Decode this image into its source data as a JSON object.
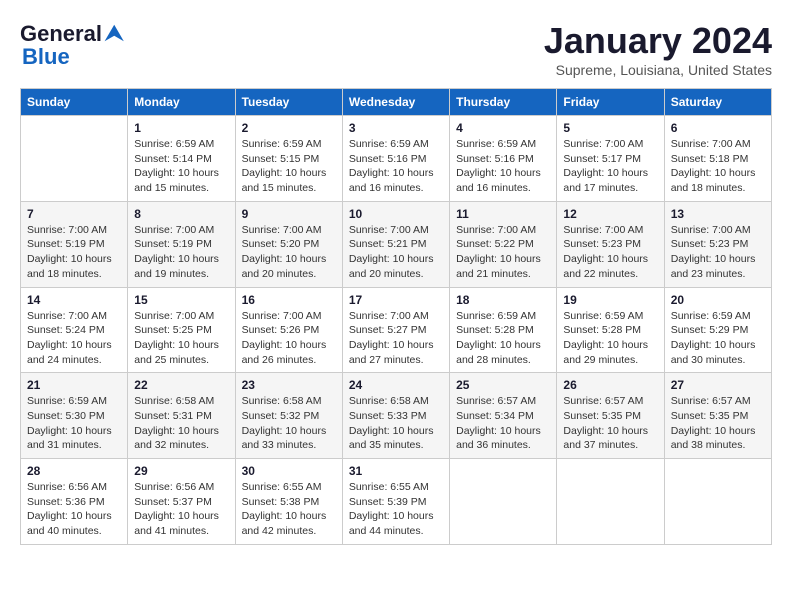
{
  "header": {
    "logo_line1": "General",
    "logo_line2": "Blue",
    "month_title": "January 2024",
    "subtitle": "Supreme, Louisiana, United States"
  },
  "days_of_week": [
    "Sunday",
    "Monday",
    "Tuesday",
    "Wednesday",
    "Thursday",
    "Friday",
    "Saturday"
  ],
  "weeks": [
    [
      {
        "day": "",
        "info": ""
      },
      {
        "day": "1",
        "info": "Sunrise: 6:59 AM\nSunset: 5:14 PM\nDaylight: 10 hours\nand 15 minutes."
      },
      {
        "day": "2",
        "info": "Sunrise: 6:59 AM\nSunset: 5:15 PM\nDaylight: 10 hours\nand 15 minutes."
      },
      {
        "day": "3",
        "info": "Sunrise: 6:59 AM\nSunset: 5:16 PM\nDaylight: 10 hours\nand 16 minutes."
      },
      {
        "day": "4",
        "info": "Sunrise: 6:59 AM\nSunset: 5:16 PM\nDaylight: 10 hours\nand 16 minutes."
      },
      {
        "day": "5",
        "info": "Sunrise: 7:00 AM\nSunset: 5:17 PM\nDaylight: 10 hours\nand 17 minutes."
      },
      {
        "day": "6",
        "info": "Sunrise: 7:00 AM\nSunset: 5:18 PM\nDaylight: 10 hours\nand 18 minutes."
      }
    ],
    [
      {
        "day": "7",
        "info": "Sunrise: 7:00 AM\nSunset: 5:19 PM\nDaylight: 10 hours\nand 18 minutes."
      },
      {
        "day": "8",
        "info": "Sunrise: 7:00 AM\nSunset: 5:19 PM\nDaylight: 10 hours\nand 19 minutes."
      },
      {
        "day": "9",
        "info": "Sunrise: 7:00 AM\nSunset: 5:20 PM\nDaylight: 10 hours\nand 20 minutes."
      },
      {
        "day": "10",
        "info": "Sunrise: 7:00 AM\nSunset: 5:21 PM\nDaylight: 10 hours\nand 20 minutes."
      },
      {
        "day": "11",
        "info": "Sunrise: 7:00 AM\nSunset: 5:22 PM\nDaylight: 10 hours\nand 21 minutes."
      },
      {
        "day": "12",
        "info": "Sunrise: 7:00 AM\nSunset: 5:23 PM\nDaylight: 10 hours\nand 22 minutes."
      },
      {
        "day": "13",
        "info": "Sunrise: 7:00 AM\nSunset: 5:23 PM\nDaylight: 10 hours\nand 23 minutes."
      }
    ],
    [
      {
        "day": "14",
        "info": "Sunrise: 7:00 AM\nSunset: 5:24 PM\nDaylight: 10 hours\nand 24 minutes."
      },
      {
        "day": "15",
        "info": "Sunrise: 7:00 AM\nSunset: 5:25 PM\nDaylight: 10 hours\nand 25 minutes."
      },
      {
        "day": "16",
        "info": "Sunrise: 7:00 AM\nSunset: 5:26 PM\nDaylight: 10 hours\nand 26 minutes."
      },
      {
        "day": "17",
        "info": "Sunrise: 7:00 AM\nSunset: 5:27 PM\nDaylight: 10 hours\nand 27 minutes."
      },
      {
        "day": "18",
        "info": "Sunrise: 6:59 AM\nSunset: 5:28 PM\nDaylight: 10 hours\nand 28 minutes."
      },
      {
        "day": "19",
        "info": "Sunrise: 6:59 AM\nSunset: 5:28 PM\nDaylight: 10 hours\nand 29 minutes."
      },
      {
        "day": "20",
        "info": "Sunrise: 6:59 AM\nSunset: 5:29 PM\nDaylight: 10 hours\nand 30 minutes."
      }
    ],
    [
      {
        "day": "21",
        "info": "Sunrise: 6:59 AM\nSunset: 5:30 PM\nDaylight: 10 hours\nand 31 minutes."
      },
      {
        "day": "22",
        "info": "Sunrise: 6:58 AM\nSunset: 5:31 PM\nDaylight: 10 hours\nand 32 minutes."
      },
      {
        "day": "23",
        "info": "Sunrise: 6:58 AM\nSunset: 5:32 PM\nDaylight: 10 hours\nand 33 minutes."
      },
      {
        "day": "24",
        "info": "Sunrise: 6:58 AM\nSunset: 5:33 PM\nDaylight: 10 hours\nand 35 minutes."
      },
      {
        "day": "25",
        "info": "Sunrise: 6:57 AM\nSunset: 5:34 PM\nDaylight: 10 hours\nand 36 minutes."
      },
      {
        "day": "26",
        "info": "Sunrise: 6:57 AM\nSunset: 5:35 PM\nDaylight: 10 hours\nand 37 minutes."
      },
      {
        "day": "27",
        "info": "Sunrise: 6:57 AM\nSunset: 5:35 PM\nDaylight: 10 hours\nand 38 minutes."
      }
    ],
    [
      {
        "day": "28",
        "info": "Sunrise: 6:56 AM\nSunset: 5:36 PM\nDaylight: 10 hours\nand 40 minutes."
      },
      {
        "day": "29",
        "info": "Sunrise: 6:56 AM\nSunset: 5:37 PM\nDaylight: 10 hours\nand 41 minutes."
      },
      {
        "day": "30",
        "info": "Sunrise: 6:55 AM\nSunset: 5:38 PM\nDaylight: 10 hours\nand 42 minutes."
      },
      {
        "day": "31",
        "info": "Sunrise: 6:55 AM\nSunset: 5:39 PM\nDaylight: 10 hours\nand 44 minutes."
      },
      {
        "day": "",
        "info": ""
      },
      {
        "day": "",
        "info": ""
      },
      {
        "day": "",
        "info": ""
      }
    ]
  ]
}
